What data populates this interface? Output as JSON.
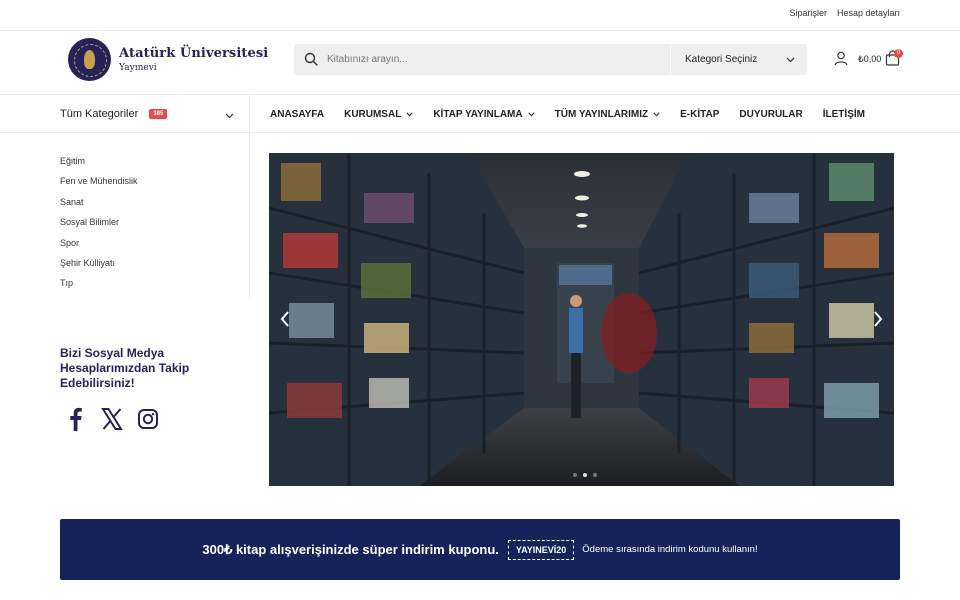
{
  "topbar": {
    "links": [
      "Siparişler",
      "Hesap detayları"
    ]
  },
  "header": {
    "logo_name": "Atatürk Üniversitesi",
    "logo_sub": "Yayınevi",
    "search_placeholder": "Kitabınızı arayın...",
    "category_select": "Kategori Seçiniz",
    "cart_total": "₺0,00",
    "cart_count": "0"
  },
  "navbar": {
    "all_categories": "Tüm Kategoriler",
    "category_count": "385",
    "menu": [
      {
        "label": "ANASAYFA",
        "dropdown": false
      },
      {
        "label": "KURUMSAL",
        "dropdown": true
      },
      {
        "label": "KİTAP YAYINLAMA",
        "dropdown": true
      },
      {
        "label": "TÜM YAYINLARIMIZ",
        "dropdown": true
      },
      {
        "label": "E-KİTAP",
        "dropdown": false
      },
      {
        "label": "DUYURULAR",
        "dropdown": false
      },
      {
        "label": "İLETİŞİM",
        "dropdown": false
      }
    ]
  },
  "sidebar": {
    "categories": [
      "Eğitim",
      "Fen ve Mühendislik",
      "Sanat",
      "Sosyal Bilimler",
      "Spor",
      "Şehir Külliyatı",
      "Tıp"
    ],
    "social_title": "Bizi Sosyal Medya Hesaplarımızdan Takip Edebilirsiniz!",
    "social_icons": [
      "facebook-icon",
      "x-icon",
      "instagram-icon"
    ]
  },
  "slider": {
    "image": "bookstore-interior-photo",
    "active_slide": 2,
    "slide_count": 3
  },
  "banner": {
    "headline": "300₺ kitap alışverişinizde süper indirim kuponu.",
    "code": "YAYINEVİ20",
    "note": "Ödeme sırasında indirim kodunu kullanın!"
  },
  "colors": {
    "brand": "#27215a",
    "banner_bg": "#15235a",
    "badge": "#e64b4b"
  }
}
